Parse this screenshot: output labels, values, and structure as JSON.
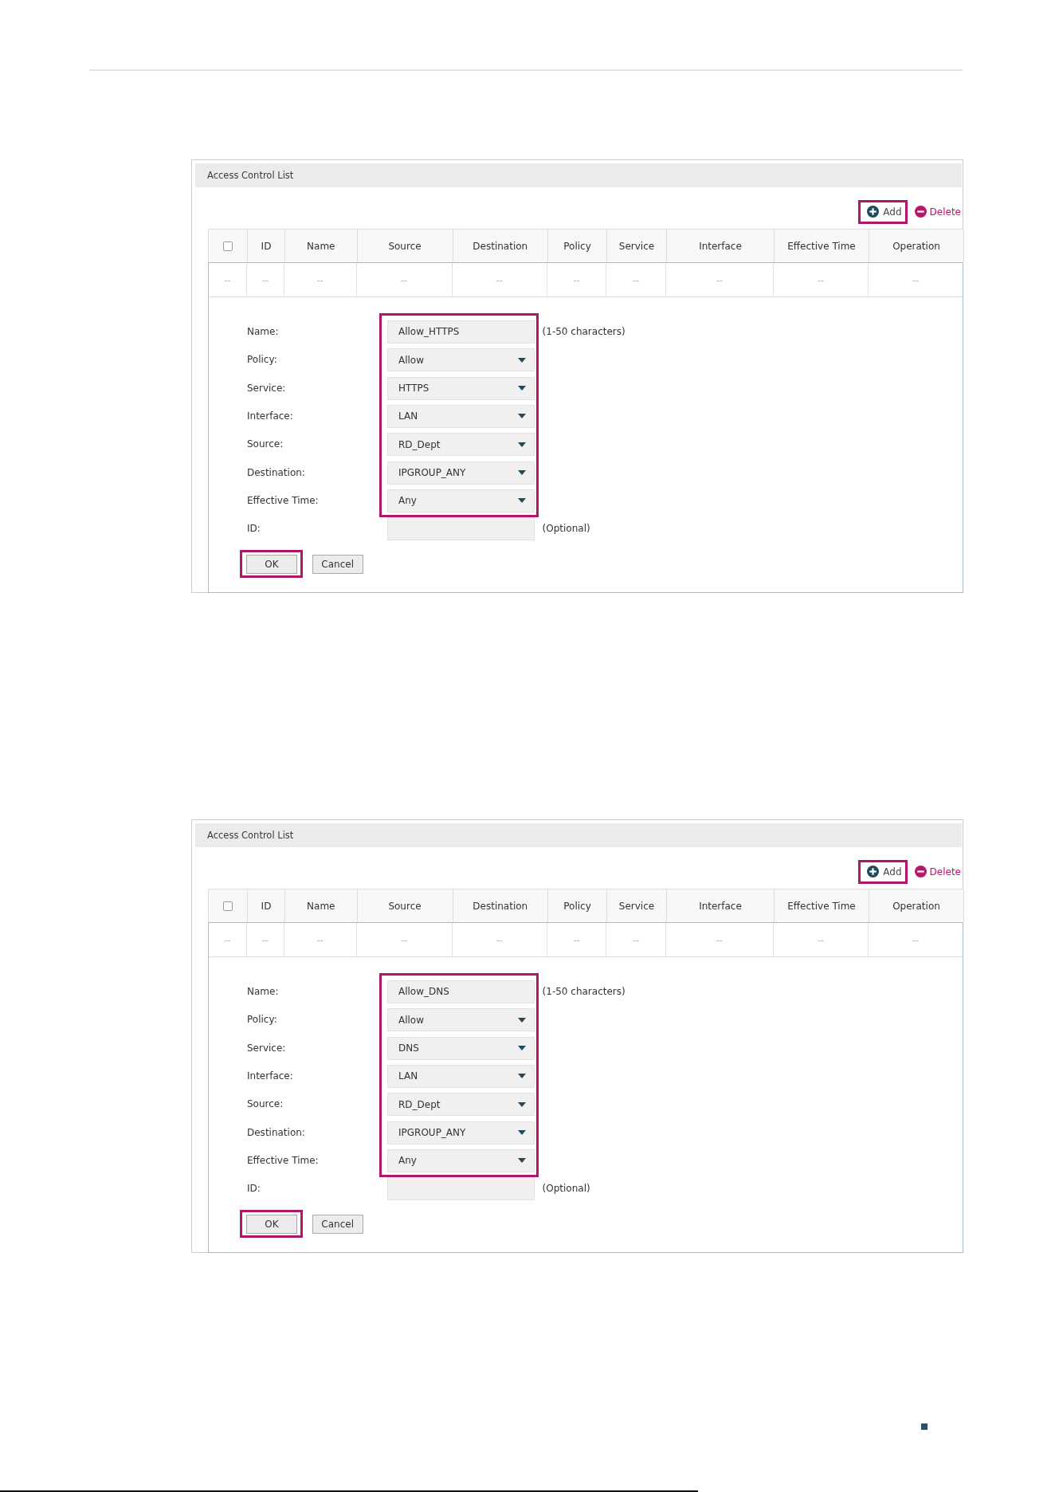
{
  "panels": [
    {
      "title": "Access Control List",
      "toolbar": [
        {
          "kind": "add",
          "label": "Add",
          "highlighted": true
        },
        {
          "kind": "delete",
          "label": "Delete",
          "highlighted": false
        }
      ],
      "table": {
        "columns": [
          {
            "kind": "checkbox",
            "checked": false
          },
          {
            "kind": "text",
            "label": "ID"
          },
          {
            "kind": "text",
            "label": "Name"
          },
          {
            "kind": "text",
            "label": "Source"
          },
          {
            "kind": "text",
            "label": "Destination"
          },
          {
            "kind": "text",
            "label": "Policy"
          },
          {
            "kind": "text",
            "label": "Service"
          },
          {
            "kind": "text",
            "label": "Interface"
          },
          {
            "kind": "text",
            "label": "Effective Time"
          },
          {
            "kind": "text",
            "label": "Operation"
          }
        ],
        "rows": [
          [
            "--",
            "--",
            "--",
            "--",
            "--",
            "--",
            "--",
            "--",
            "--",
            "--"
          ]
        ]
      },
      "form": {
        "field_groups": [
          {
            "highlighted": true,
            "fields": [
              {
                "kind": "text",
                "label": "Name:",
                "value": "Allow_HTTPS",
                "hint": "(1-50 characters)"
              },
              {
                "kind": "select",
                "label": "Policy:",
                "value": "Allow"
              },
              {
                "kind": "select",
                "label": "Service:",
                "value": "HTTPS"
              },
              {
                "kind": "select",
                "label": "Interface:",
                "value": "LAN"
              },
              {
                "kind": "select",
                "label": "Source:",
                "value": "RD_Dept"
              },
              {
                "kind": "select",
                "label": "Destination:",
                "value": "IPGROUP_ANY"
              },
              {
                "kind": "select",
                "label": "Effective Time:",
                "value": "Any"
              }
            ]
          },
          {
            "highlighted": false,
            "fields": [
              {
                "kind": "text",
                "label": "ID:",
                "hint": "(Optional)"
              }
            ]
          }
        ],
        "buttons": [
          {
            "label": "OK",
            "highlighted": true
          },
          {
            "label": "Cancel",
            "highlighted": false
          }
        ]
      }
    },
    {
      "title": "Access Control List",
      "toolbar": [
        {
          "kind": "add",
          "label": "Add",
          "highlighted": true
        },
        {
          "kind": "delete",
          "label": "Delete",
          "highlighted": false
        }
      ],
      "table": {
        "columns": [
          {
            "kind": "checkbox",
            "checked": false
          },
          {
            "kind": "text",
            "label": "ID"
          },
          {
            "kind": "text",
            "label": "Name"
          },
          {
            "kind": "text",
            "label": "Source"
          },
          {
            "kind": "text",
            "label": "Destination"
          },
          {
            "kind": "text",
            "label": "Policy"
          },
          {
            "kind": "text",
            "label": "Service"
          },
          {
            "kind": "text",
            "label": "Interface"
          },
          {
            "kind": "text",
            "label": "Effective Time"
          },
          {
            "kind": "text",
            "label": "Operation"
          }
        ],
        "rows": [
          [
            "--",
            "--",
            "--",
            "--",
            "--",
            "--",
            "--",
            "--",
            "--",
            "--"
          ]
        ]
      },
      "form": {
        "field_groups": [
          {
            "highlighted": true,
            "fields": [
              {
                "kind": "text",
                "label": "Name:",
                "value": "Allow_DNS",
                "hint": "(1-50 characters)"
              },
              {
                "kind": "select",
                "label": "Policy:",
                "value": "Allow"
              },
              {
                "kind": "select",
                "label": "Service:",
                "value": "DNS"
              },
              {
                "kind": "select",
                "label": "Interface:",
                "value": "LAN"
              },
              {
                "kind": "select",
                "label": "Source:",
                "value": "RD_Dept"
              },
              {
                "kind": "select",
                "label": "Destination:",
                "value": "IPGROUP_ANY"
              },
              {
                "kind": "select",
                "label": "Effective Time:",
                "value": "Any"
              }
            ]
          },
          {
            "highlighted": false,
            "fields": [
              {
                "kind": "text",
                "label": "ID:",
                "hint": "(Optional)"
              }
            ]
          }
        ],
        "buttons": [
          {
            "label": "OK",
            "highlighted": true
          },
          {
            "label": "Cancel",
            "highlighted": false
          }
        ]
      }
    }
  ]
}
